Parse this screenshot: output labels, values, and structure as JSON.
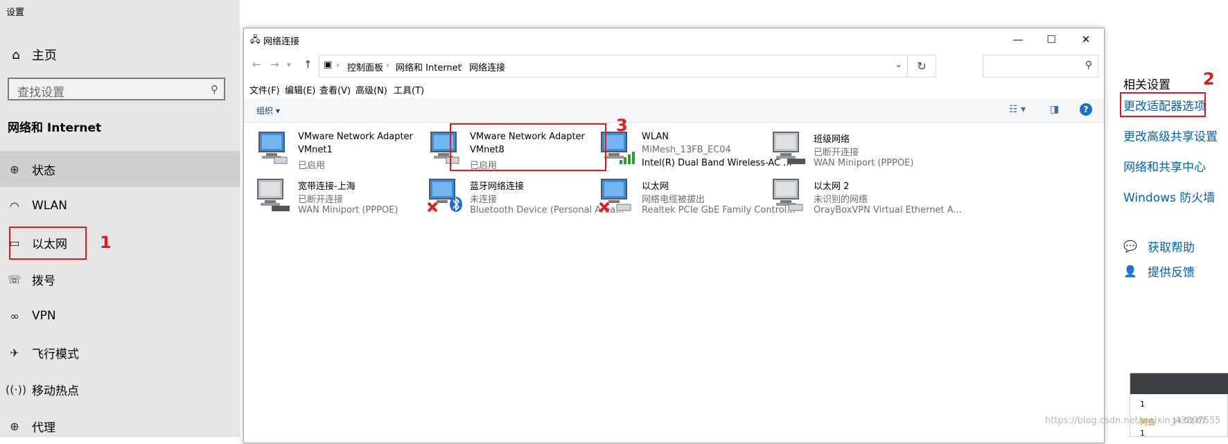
{
  "settings": {
    "title": "设置",
    "home": {
      "icon": "home-icon",
      "label": "主页"
    },
    "search_placeholder": "查找设置",
    "section_title": "网络和 Internet",
    "nav_items": [
      {
        "icon": "globe-icon",
        "label": "状态",
        "selected": true
      },
      {
        "icon": "wifi-icon",
        "label": "WLAN"
      },
      {
        "icon": "monitor-icon",
        "label": "以太网"
      },
      {
        "icon": "phone-icon",
        "label": "拨号"
      },
      {
        "icon": "vpn-icon",
        "label": "VPN"
      },
      {
        "icon": "airplane-icon",
        "label": "飞行模式"
      },
      {
        "icon": "hotspot-icon",
        "label": "移动热点"
      },
      {
        "icon": "globe-icon",
        "label": "代理"
      }
    ]
  },
  "explorer": {
    "title": "网络连接",
    "breadcrumb": [
      "控制面板",
      "网络和 Internet",
      "网络连接"
    ],
    "menu": [
      "文件(F)",
      "编辑(E)",
      "查看(V)",
      "高级(N)",
      "工具(T)"
    ],
    "organize_label": "组织 ▾",
    "connections": [
      {
        "name": "VMware Network Adapter",
        "line2": "VMnet1",
        "line3": "已启用",
        "kind": "vmware"
      },
      {
        "name": "VMware Network Adapter",
        "line2": "VMnet8",
        "line3": "已启用",
        "kind": "vmware"
      },
      {
        "name": "WLAN",
        "line2": "MiMesh_13FB_EC04",
        "line3": "Intel(R) Dual Band Wireless-AC ...",
        "kind": "wlan"
      },
      {
        "name": "班级网络",
        "line2": "已断开连接",
        "line3": "WAN Miniport (PPPOE)",
        "kind": "dialup"
      },
      {
        "name": "宽带连接-上海",
        "line2": "已断开连接",
        "line3": "WAN Miniport (PPPOE)",
        "kind": "dialup"
      },
      {
        "name": "蓝牙网络连接",
        "line2": "未连接",
        "line3": "Bluetooth Device (Personal Area...",
        "kind": "bluetooth"
      },
      {
        "name": "以太网",
        "line2": "网络电缆被拔出",
        "line3": "Realtek PCIe GbE Family Control...",
        "kind": "ethernet-x"
      },
      {
        "name": "以太网 2",
        "line2": "未识别的网络",
        "line3": "OrayBoxVPN Virtual Ethernet A...",
        "kind": "ethernet"
      }
    ]
  },
  "related": {
    "title": "相关设置",
    "links": [
      "更改适配器选项",
      "更改高级共享设置",
      "网络和共享中心",
      "Windows 防火墙"
    ],
    "help": [
      {
        "icon": "chat-help-icon",
        "label": "获取帮助"
      },
      {
        "icon": "feedback-icon",
        "label": "提供反馈"
      }
    ]
  },
  "annotations": [
    "1",
    "2",
    "3"
  ],
  "popup": {
    "row1": "1",
    "row2": "阿白",
    "row3": "14:02:07",
    "row4": "1"
  },
  "watermark": "https://blog.csdn.net/weixin_43807555",
  "colors": {
    "accent": "#0063b1",
    "annotation": "#e0191e",
    "sidebar": "#e6e6e6"
  }
}
